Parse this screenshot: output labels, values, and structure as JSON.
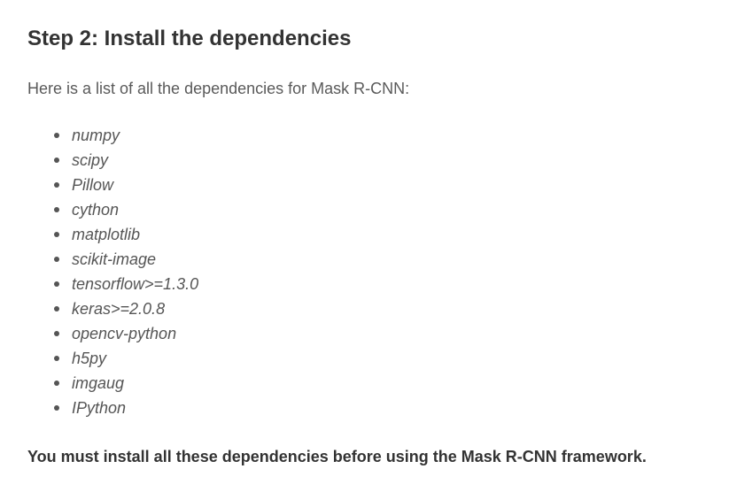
{
  "article": {
    "heading": "Step 2: Install the dependencies",
    "intro": "Here is a list of all the dependencies for Mask R-CNN:",
    "dependencies": [
      "numpy",
      "scipy",
      "Pillow",
      "cython",
      "matplotlib",
      "scikit-image",
      "tensorflow>=1.3.0",
      "keras>=2.0.8",
      "opencv-python",
      "h5py",
      "imgaug",
      "IPython"
    ],
    "note": "You must install all these dependencies before using the Mask R-CNN framework."
  },
  "colors": {
    "heading": "#333333",
    "body_text": "#555555",
    "background": "#ffffff"
  }
}
